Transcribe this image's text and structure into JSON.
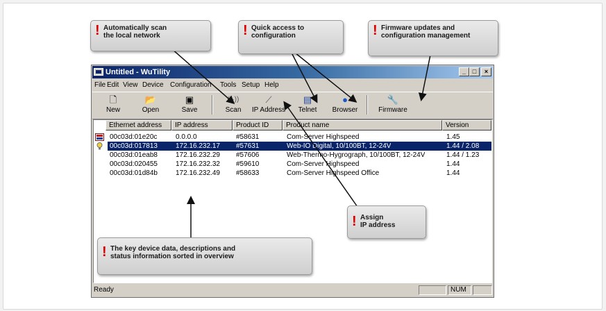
{
  "window": {
    "title": "Untitled - WuTility",
    "controls": [
      "_",
      "□",
      "×"
    ]
  },
  "menu": [
    "File",
    "Edit",
    "View",
    "Device",
    "Configuration",
    "Tools",
    "Setup",
    "Help"
  ],
  "toolbar": [
    {
      "label": "New",
      "icon": "new-file-icon"
    },
    {
      "label": "Open",
      "icon": "open-folder-icon"
    },
    {
      "label": "Save",
      "icon": "save-disk-icon"
    },
    {
      "label": "Scan",
      "icon": "scan-radio-icon"
    },
    {
      "label": "IP Address",
      "icon": "ip-wand-icon"
    },
    {
      "label": "Telnet",
      "icon": "telnet-terminal-icon"
    },
    {
      "label": "Browser",
      "icon": "browser-globe-icon"
    },
    {
      "label": "Firmware",
      "icon": "firmware-wrench-icon"
    }
  ],
  "table": {
    "columns": [
      "Ethernet address",
      "IP address",
      "Product ID",
      "Product name",
      "Version"
    ],
    "rows": [
      {
        "mac": "00c03d:01e20c",
        "ip": "0.0.0.0",
        "pid": "#58631",
        "name": "Com-Server Highspeed",
        "version": "1.45",
        "icon": "device-warning-icon"
      },
      {
        "mac": "00c03d:017813",
        "ip": "172.16.232.17",
        "pid": "#57631",
        "name": "Web-IO Digital, 10/100BT, 12-24V",
        "version": "1.44 / 2.08",
        "icon": "lightbulb-icon",
        "selected": true
      },
      {
        "mac": "00c03d:01eab8",
        "ip": "172.16.232.29",
        "pid": "#57606",
        "name": "Web-Thermo-Hygrograph, 10/100BT, 12-24V",
        "version": "1.44 / 1.23"
      },
      {
        "mac": "00c03d:020455",
        "ip": "172.16.232.32",
        "pid": "#59610",
        "name": "Com-Server Highspeed",
        "version": "1.44"
      },
      {
        "mac": "00c03d:01d84b",
        "ip": "172.16.232.49",
        "pid": "#58633",
        "name": "Com-Server Highspeed Office",
        "version": "1.44"
      }
    ]
  },
  "status": {
    "text": "Ready",
    "num": "NUM"
  },
  "callouts": {
    "scan": "Automatically scan\nthe local network",
    "config": "Quick access to\nconfiguration",
    "firmware": "Firmware updates and\nconfiguration management",
    "assign": "Assign\nIP address",
    "data": "The key device data, descriptions and\nstatus information sorted in overview"
  },
  "colors": {
    "selection": "#0a246a",
    "titlebar_start": "#0a246a",
    "callout_mark": "#e00000"
  }
}
